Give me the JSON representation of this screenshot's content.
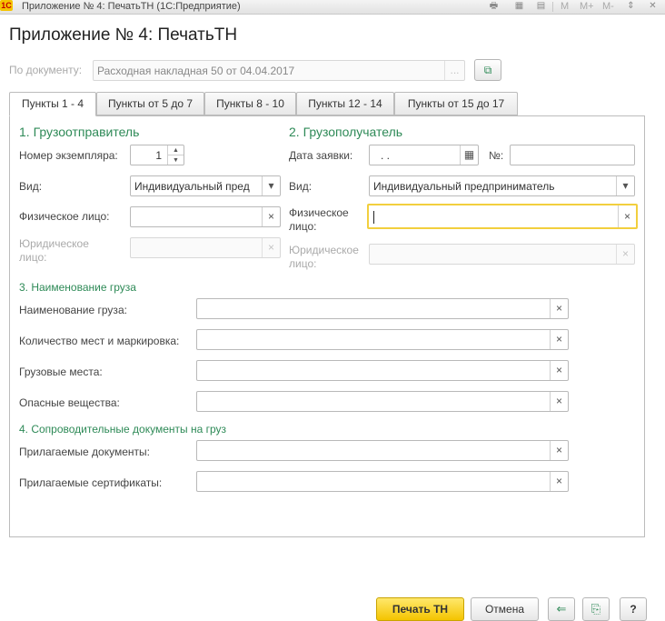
{
  "window": {
    "app_logo": "1С",
    "title": "Приложение № 4: ПечатьТН  (1С:Предприятие)",
    "memory_buttons": [
      "M",
      "M+",
      "M-"
    ]
  },
  "page_title": "Приложение № 4: ПечатьТН",
  "document": {
    "label": "По документу:",
    "value": "Расходная накладная 50 от 04.04.2017",
    "select_button": "..."
  },
  "tabs": [
    {
      "label": "Пункты 1 - 4",
      "active": true
    },
    {
      "label": "Пункты от 5 до 7"
    },
    {
      "label": "Пункты 8 - 10"
    },
    {
      "label": "Пункты 12 - 14"
    },
    {
      "label": "Пункты от 15 до 17"
    }
  ],
  "shipper": {
    "title": "1. Грузоотправитель",
    "copy_number_label": "Номер экземпляра:",
    "copy_number_value": "1",
    "kind_label": "Вид:",
    "kind_value": "Индивидуальный пред",
    "person_label": "Физическое лицо:",
    "person_value": "",
    "legal_label": "Юридическое лицо:",
    "legal_value": ""
  },
  "consignee": {
    "title": "2. Грузополучатель",
    "date_label": "Дата заявки:",
    "date_value": "  .  .",
    "number_label": "№:",
    "number_value": "",
    "kind_label": "Вид:",
    "kind_value": "Индивидуальный предприниматель",
    "person_label": "Физическое лицо:",
    "person_value": "",
    "legal_label": "Юридическое лицо:",
    "legal_value": ""
  },
  "cargo": {
    "title": "3. Наименование груза",
    "fields": [
      {
        "label": "Наименование груза:",
        "value": ""
      },
      {
        "label": "Количество мест и маркировка:",
        "value": ""
      },
      {
        "label": "Грузовые места:",
        "value": ""
      },
      {
        "label": "Опасные вещества:",
        "value": ""
      }
    ]
  },
  "docs": {
    "title": "4. Сопроводительные документы на груз",
    "fields": [
      {
        "label": "Прилагаемые документы:",
        "value": ""
      },
      {
        "label": "Прилагаемые сертификаты:",
        "value": ""
      }
    ]
  },
  "footer": {
    "print_button": "Печать ТН",
    "cancel_button": "Отмена",
    "help_button": "?"
  },
  "icons": {
    "clear": "×",
    "dropdown": "▾",
    "calendar": "▦",
    "spin_up": "▲",
    "spin_down": "▼"
  },
  "colors": {
    "section_title": "#2e8a57",
    "primary_button": "#f4c400",
    "focus_border": "#f2cf3e"
  }
}
